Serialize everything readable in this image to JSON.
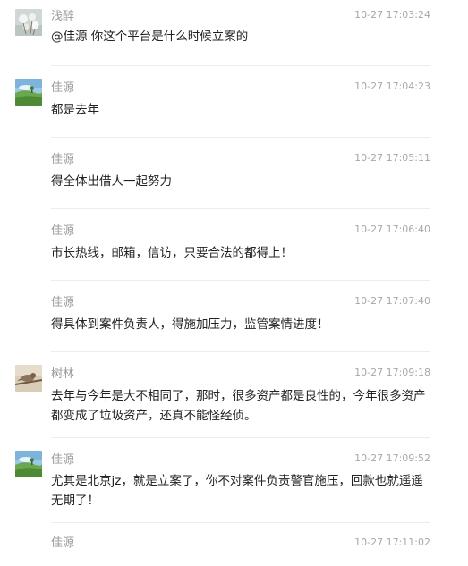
{
  "messages": [
    {
      "author": "浅醉",
      "time": "10-27 17:03:24",
      "text": "@佳源 你这个平台是什么时候立案的",
      "avatar": "cotton-flower-avatar"
    },
    {
      "author": "佳源",
      "time": "10-27 17:04:23",
      "text": "都是去年",
      "avatar": "green-field-avatar"
    },
    {
      "author": "佳源",
      "time": "10-27 17:05:11",
      "text": "得全体出借人一起努力",
      "avatar": ""
    },
    {
      "author": "佳源",
      "time": "10-27 17:06:40",
      "text": "市长热线，邮箱，信访，只要合法的都得上！",
      "avatar": ""
    },
    {
      "author": "佳源",
      "time": "10-27 17:07:40",
      "text": "得具体到案件负责人，得施加压力，监管案情进度！",
      "avatar": ""
    },
    {
      "author": "树林",
      "time": "10-27 17:09:18",
      "text": "去年与今年是大不相同了，那时，很多资产都是良性的，今年很多资产都变成了垃圾资产，还真不能怪经侦。",
      "avatar": "bird-branch-avatar"
    },
    {
      "author": "佳源",
      "time": "10-27 17:09:52",
      "text": "尤其是北京jz，就是立案了，你不对案件负责警官施压，回款也就遥遥无期了！",
      "avatar": "green-field-avatar"
    },
    {
      "author": "佳源",
      "time": "10-27 17:11:02",
      "text": "",
      "avatar": ""
    }
  ],
  "colors": {
    "author": "#9a9a9a",
    "time": "#a8a8a8",
    "text": "#222222",
    "divider": "#ececec"
  }
}
